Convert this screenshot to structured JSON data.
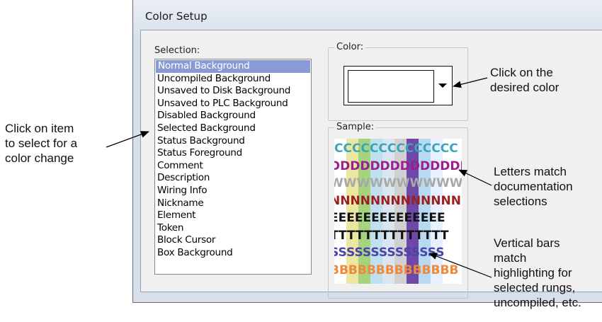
{
  "dialog": {
    "title": "Color Setup",
    "selection_label": "Selection:",
    "items": [
      "Normal Background",
      "Uncompiled Background",
      "Unsaved to Disk Background",
      "Unsaved to PLC Background",
      "Disabled Background",
      "Selected Background",
      "Status Background",
      "Status Foreground",
      "Comment",
      "Description",
      "Wiring Info",
      "Nickname",
      "Element",
      "Token",
      "Block Cursor",
      "Box Background"
    ],
    "selected_item": "Normal Background",
    "color_label": "Color:",
    "current_color": "#ffffff",
    "sample_label": "Sample:"
  },
  "sample": {
    "bars": [
      "#ffffff",
      "#ebe6a0",
      "#a6d47e",
      "#bfe0ef",
      "#d9e6f0",
      "#d0d0d0",
      "#6e47a8",
      "#b8d9f2",
      "#e6f0ff"
    ],
    "rows": [
      {
        "text": "CCCCCCCCCCCCCC",
        "color": "#3aa6b9"
      },
      {
        "text": "DDDDDDDDDDDDDD",
        "color": "#9b1f8f"
      },
      {
        "text": "WWWWWWWWWWWWWW",
        "color": "#a8a8a8"
      },
      {
        "text": "NNNNNNNNNNNNNN",
        "color": "#9c1f1f"
      },
      {
        "text": "EEEEEEEEEEEEEE",
        "color": "#111111"
      },
      {
        "text": "TTTTTTTTTTTTTT",
        "color": "#111111"
      },
      {
        "text": "SSSSSSSSSSSSSS",
        "color": "#4b43a8"
      },
      {
        "text": "BBBBBBBBBBBBBB",
        "color": "#f0883a"
      }
    ]
  },
  "callouts": {
    "color": "Click on the\ndesired color",
    "item": "Click on item\nto select for a\ncolor change",
    "letters": "Letters match\ndocumentation\nselections",
    "bars": "Vertical bars\nmatch\nhighlighting for\nselected rungs,\nuncompiled, etc."
  }
}
